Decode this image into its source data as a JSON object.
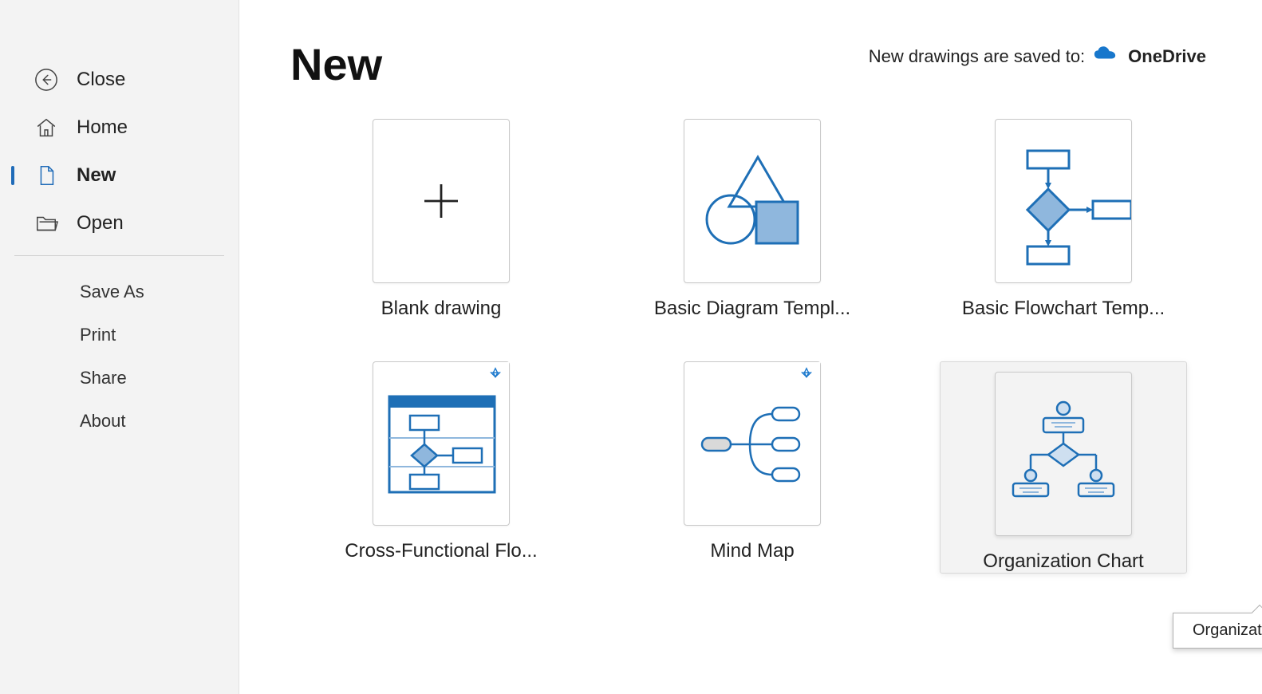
{
  "sidebar": {
    "primary": [
      {
        "id": "close",
        "label": "Close",
        "icon": "back"
      },
      {
        "id": "home",
        "label": "Home",
        "icon": "home"
      },
      {
        "id": "new",
        "label": "New",
        "icon": "file",
        "active": true
      },
      {
        "id": "open",
        "label": "Open",
        "icon": "folder"
      }
    ],
    "secondary": [
      {
        "id": "saveas",
        "label": "Save As"
      },
      {
        "id": "print",
        "label": "Print"
      },
      {
        "id": "share",
        "label": "Share"
      },
      {
        "id": "about",
        "label": "About"
      }
    ]
  },
  "page": {
    "title": "New",
    "save_target_prefix": "New drawings are saved to:",
    "save_target_name": "OneDrive"
  },
  "templates": [
    {
      "id": "blank",
      "label": "Blank drawing",
      "art": "plus",
      "premium": false
    },
    {
      "id": "basicdiag",
      "label": "Basic Diagram Templ...",
      "art": "shapes",
      "premium": false
    },
    {
      "id": "basicflow",
      "label": "Basic Flowchart Temp...",
      "art": "flowchart",
      "premium": false
    },
    {
      "id": "crossfunc",
      "label": "Cross-Functional Flo...",
      "art": "swimlane",
      "premium": true
    },
    {
      "id": "mindmap",
      "label": "Mind Map",
      "art": "mindmap",
      "premium": true
    },
    {
      "id": "orgchart",
      "label": "Organization Chart",
      "art": "orgchart",
      "premium": false,
      "hovered": true
    }
  ],
  "tooltip": {
    "text": "Organization Chart"
  }
}
